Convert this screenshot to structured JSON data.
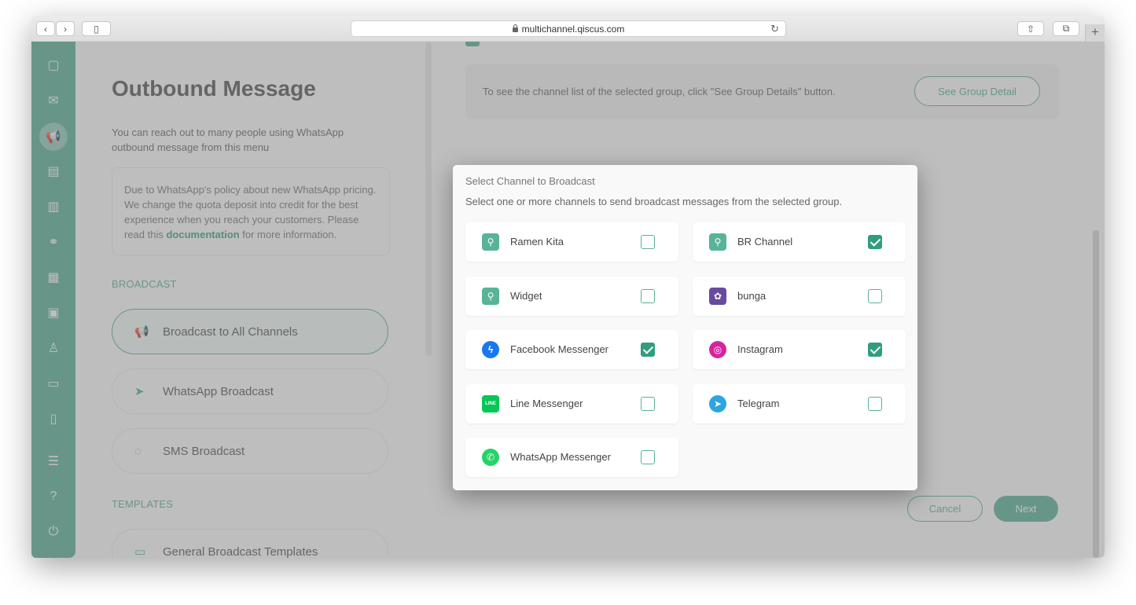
{
  "browser": {
    "url": "multichannel.qiscus.com",
    "new_tab": "+"
  },
  "sidebar": {
    "items": [
      "chat-icon",
      "inbox-icon",
      "broadcast-icon",
      "contacts-icon",
      "analytics-icon",
      "integration-icon",
      "apps-icon",
      "bot-icon",
      "agent-icon",
      "ticket-icon",
      "mobile-icon",
      "settings-icon",
      "help-icon",
      "power-icon"
    ],
    "active": "broadcast-icon"
  },
  "left": {
    "title": "Outbound Message",
    "subtitle": "You can reach out to many people using WhatsApp outbound message from this menu",
    "notice_before": "Due to WhatsApp's policy about new WhatsApp pricing. We change the quota deposit into credit for the best experience when you reach your customers. Please read this ",
    "notice_link": "documentation",
    "notice_after": " for more information.",
    "broadcast_label": "BROADCAST",
    "broadcast_items": [
      "Broadcast to All Channels",
      "WhatsApp Broadcast",
      "SMS Broadcast"
    ],
    "templates_label": "TEMPLATES",
    "templates_items": [
      "General Broadcast Templates"
    ]
  },
  "right": {
    "group_info": "To see the channel list of the selected group, click \"See Group Details\" button.",
    "group_button": "See Group Detail",
    "cancel": "Cancel",
    "next": "Next"
  },
  "modal": {
    "title": "Select Channel to Broadcast",
    "subtitle": "Select one or more channels to send broadcast messages from the selected group.",
    "channels": [
      {
        "name": "Ramen Kita",
        "icon": "qiscus-icon",
        "color": "#58b398",
        "checked": false
      },
      {
        "name": "BR Channel",
        "icon": "qiscus-icon",
        "color": "#58b398",
        "checked": true
      },
      {
        "name": "Widget",
        "icon": "qiscus-icon",
        "color": "#58b398",
        "checked": false
      },
      {
        "name": "bunga",
        "icon": "flower-avatar",
        "color": "#6a4aa0",
        "checked": false
      },
      {
        "name": "Facebook Messenger",
        "icon": "messenger-icon",
        "color": "#1877f2",
        "checked": true
      },
      {
        "name": "Instagram",
        "icon": "instagram-icon",
        "color": "#d6249f",
        "checked": true
      },
      {
        "name": "Line Messenger",
        "icon": "line-icon",
        "color": "#06c755",
        "checked": false
      },
      {
        "name": "Telegram",
        "icon": "telegram-icon",
        "color": "#2ca5e0",
        "checked": false
      },
      {
        "name": "WhatsApp Messenger",
        "icon": "whatsapp-icon",
        "color": "#25d366",
        "checked": false
      }
    ]
  }
}
